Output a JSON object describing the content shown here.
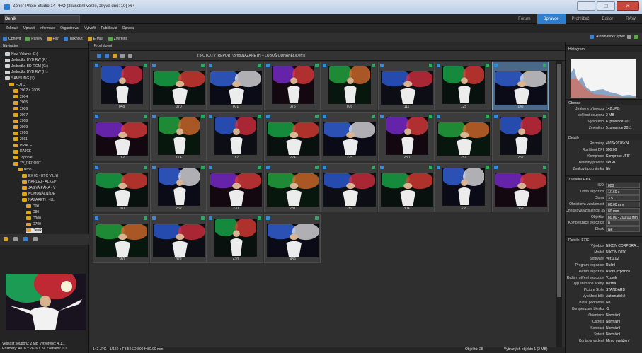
{
  "titlebar": {
    "text": "Zoner Photo Studio 14 PRO (zkušební verze, zbývá dnů: 10) x64"
  },
  "app": {
    "name": "Deník"
  },
  "modes": [
    "Fórum",
    "Správce",
    "Prohlížeč",
    "Editor",
    "RAW"
  ],
  "menu": [
    "Zobrazit",
    "Upravit",
    "Informace",
    "Organizovat",
    "Vytvořit",
    "Publikovat",
    "Oprava"
  ],
  "toolbar": [
    "Obnovit",
    "Panely",
    "Filtr",
    "Tisknout",
    "E-Mail",
    "Zveřejnit"
  ],
  "toolbar_right": "Automatický výběr",
  "left": {
    "header": "Navigátor",
    "tree": [
      {
        "label": "New Volume (E:)",
        "level": 0,
        "type": "drive"
      },
      {
        "label": "Jednotka DVD RW (F:)",
        "level": 0,
        "type": "drive"
      },
      {
        "label": "Jednotka BD-ROM (G:)",
        "level": 0,
        "type": "drive"
      },
      {
        "label": "Jednotka DVD RW (H:)",
        "level": 0,
        "type": "drive"
      },
      {
        "label": "SAMSUNG (I:)",
        "level": 0,
        "type": "drive"
      },
      {
        "label": "FOTO",
        "level": 1,
        "type": "folder"
      },
      {
        "label": "2002 a 2003",
        "level": 2,
        "type": "folder"
      },
      {
        "label": "2004",
        "level": 2,
        "type": "folder"
      },
      {
        "label": "2005",
        "level": 2,
        "type": "folder"
      },
      {
        "label": "2006",
        "level": 2,
        "type": "folder"
      },
      {
        "label": "2007",
        "level": 2,
        "type": "folder"
      },
      {
        "label": "2008",
        "level": 2,
        "type": "folder"
      },
      {
        "label": "2009",
        "level": 2,
        "type": "folder"
      },
      {
        "label": "2010",
        "level": 2,
        "type": "folder"
      },
      {
        "label": "2011",
        "level": 2,
        "type": "folder"
      },
      {
        "label": "PRACE",
        "level": 2,
        "type": "folder"
      },
      {
        "label": "RAJCE",
        "level": 2,
        "type": "folder"
      },
      {
        "label": "Toponie",
        "level": 2,
        "type": "folder"
      },
      {
        "label": "TV_REPORT",
        "level": 2,
        "type": "folder"
      },
      {
        "label": "Brno",
        "level": 3,
        "type": "folder"
      },
      {
        "label": "EX 05 - ETC VILNI",
        "level": 4,
        "type": "folder"
      },
      {
        "label": "HARLEJ - ALKEP",
        "level": 4,
        "type": "folder"
      },
      {
        "label": "JASNÁ PÁKA - V",
        "level": 4,
        "type": "folder"
      },
      {
        "label": "KOMUNÁLNÍ DE",
        "level": 4,
        "type": "folder"
      },
      {
        "label": "NAZARETH - LL",
        "level": 4,
        "type": "folder"
      },
      {
        "label": "D00",
        "level": 5,
        "type": "folder"
      },
      {
        "label": "D80",
        "level": 5,
        "type": "folder"
      },
      {
        "label": "D300",
        "level": 5,
        "type": "folder"
      },
      {
        "label": "D700",
        "level": 5,
        "type": "folder"
      },
      {
        "label": "Deník",
        "level": 5,
        "type": "folder",
        "selected": true
      }
    ],
    "status": [
      "Velikost souboru: 2 MB   Vytvořeno: 4.1...",
      "Rozměry: 4016 x 2676 x 24   Zvětšení: 1:1"
    ]
  },
  "main": {
    "path": "I:\\FOTO\\TV_REPORT\\Brno\\NAZARETH + LUBOŠ ODHÁNĚL\\Deník",
    "thumbs": [
      {
        "label": "048",
        "kind": "portrait"
      },
      {
        "label": "070",
        "kind": "wide"
      },
      {
        "label": "071",
        "kind": "wide"
      },
      {
        "label": "075",
        "kind": "portrait"
      },
      {
        "label": "076",
        "kind": "portrait"
      },
      {
        "label": "111",
        "kind": "wide"
      },
      {
        "label": "125",
        "kind": "portrait"
      },
      {
        "label": "142",
        "kind": "wide",
        "selected": true
      },
      {
        "label": "162",
        "kind": "wide"
      },
      {
        "label": "174",
        "kind": "portrait"
      },
      {
        "label": "187",
        "kind": "portrait"
      },
      {
        "label": "224",
        "kind": "wide"
      },
      {
        "label": "225",
        "kind": "wide"
      },
      {
        "label": "230",
        "kind": "portrait"
      },
      {
        "label": "251",
        "kind": "wide"
      },
      {
        "label": "252",
        "kind": "portrait"
      },
      {
        "label": "260",
        "kind": "wide"
      },
      {
        "label": "262",
        "kind": "portrait"
      },
      {
        "label": "270",
        "kind": "wide"
      },
      {
        "label": "281",
        "kind": "wide"
      },
      {
        "label": "289",
        "kind": "wide"
      },
      {
        "label": "304",
        "kind": "wide"
      },
      {
        "label": "338",
        "kind": "portrait"
      },
      {
        "label": "352",
        "kind": "wide"
      },
      {
        "label": "360",
        "kind": "wide"
      },
      {
        "label": "372",
        "kind": "wide"
      },
      {
        "label": "470",
        "kind": "portrait"
      },
      {
        "label": "489",
        "kind": "wide"
      }
    ],
    "status": "142.JPG - 1/160 s F3.5 ISO 800 f=80.00 mm",
    "count": "Objektů: 28",
    "selected": "Vybraných objektů 1 (2 MB)"
  },
  "right": {
    "sections": [
      "Histogram",
      "Obecné",
      "Detaily",
      "Základní EXIF",
      "Detailní EXIF"
    ],
    "props": [
      [
        "Jméno s příponou",
        "142.JPG"
      ],
      [
        "Velikost souboru",
        "2 MB"
      ],
      [
        "Vytvořeno",
        "6. prosince 2011"
      ],
      [
        "Změněno",
        "5. prosince 2011"
      ],
      [
        "Rozměry",
        "4016x2676x24"
      ],
      [
        "Rozlišení DPI",
        "300.00"
      ],
      [
        "Komprese",
        "Komprese JFIF"
      ],
      [
        "Barevný prostor",
        "sRGB"
      ],
      [
        "Zvuková poznámka",
        "Ne"
      ],
      [
        "ISO",
        "800"
      ],
      [
        "Doba expozice",
        "1/160 s"
      ],
      [
        "Clona",
        "3.5"
      ],
      [
        "Ohnisková vzdálenost",
        "80.00 mm"
      ],
      [
        "Ohnisková vzdálenost 35",
        "80 mm"
      ],
      [
        "Objektiv",
        "80.00 - 200.00 mm"
      ],
      [
        "Kompenzace expozice",
        "0"
      ],
      [
        "Blesk",
        "Ne"
      ],
      [
        "Výrobce",
        "NIKON CORPORATION"
      ],
      [
        "Model",
        "NIKON D700"
      ],
      [
        "Software",
        "Ver.1.02"
      ],
      [
        "Program expozice",
        "Ruční"
      ],
      [
        "Režim expozice",
        "Ruční expozice"
      ],
      [
        "Režim měření expozice",
        "Vzorek"
      ],
      [
        "Typ snímané scény",
        "Běžná"
      ],
      [
        "Picture Style",
        "STANDARD"
      ],
      [
        "Vyvážení bílé",
        "Automatické"
      ],
      [
        "Blesk podrobně",
        "Ne"
      ],
      [
        "Kompenzace blesku",
        "-1"
      ],
      [
        "Orientace",
        "Normální"
      ],
      [
        "Ostrost",
        "Normální"
      ],
      [
        "Kontrast",
        "Normální"
      ],
      [
        "Sytost",
        "Normální"
      ],
      [
        "Kontrola vedení",
        "Mimo vyvážení"
      ]
    ]
  }
}
